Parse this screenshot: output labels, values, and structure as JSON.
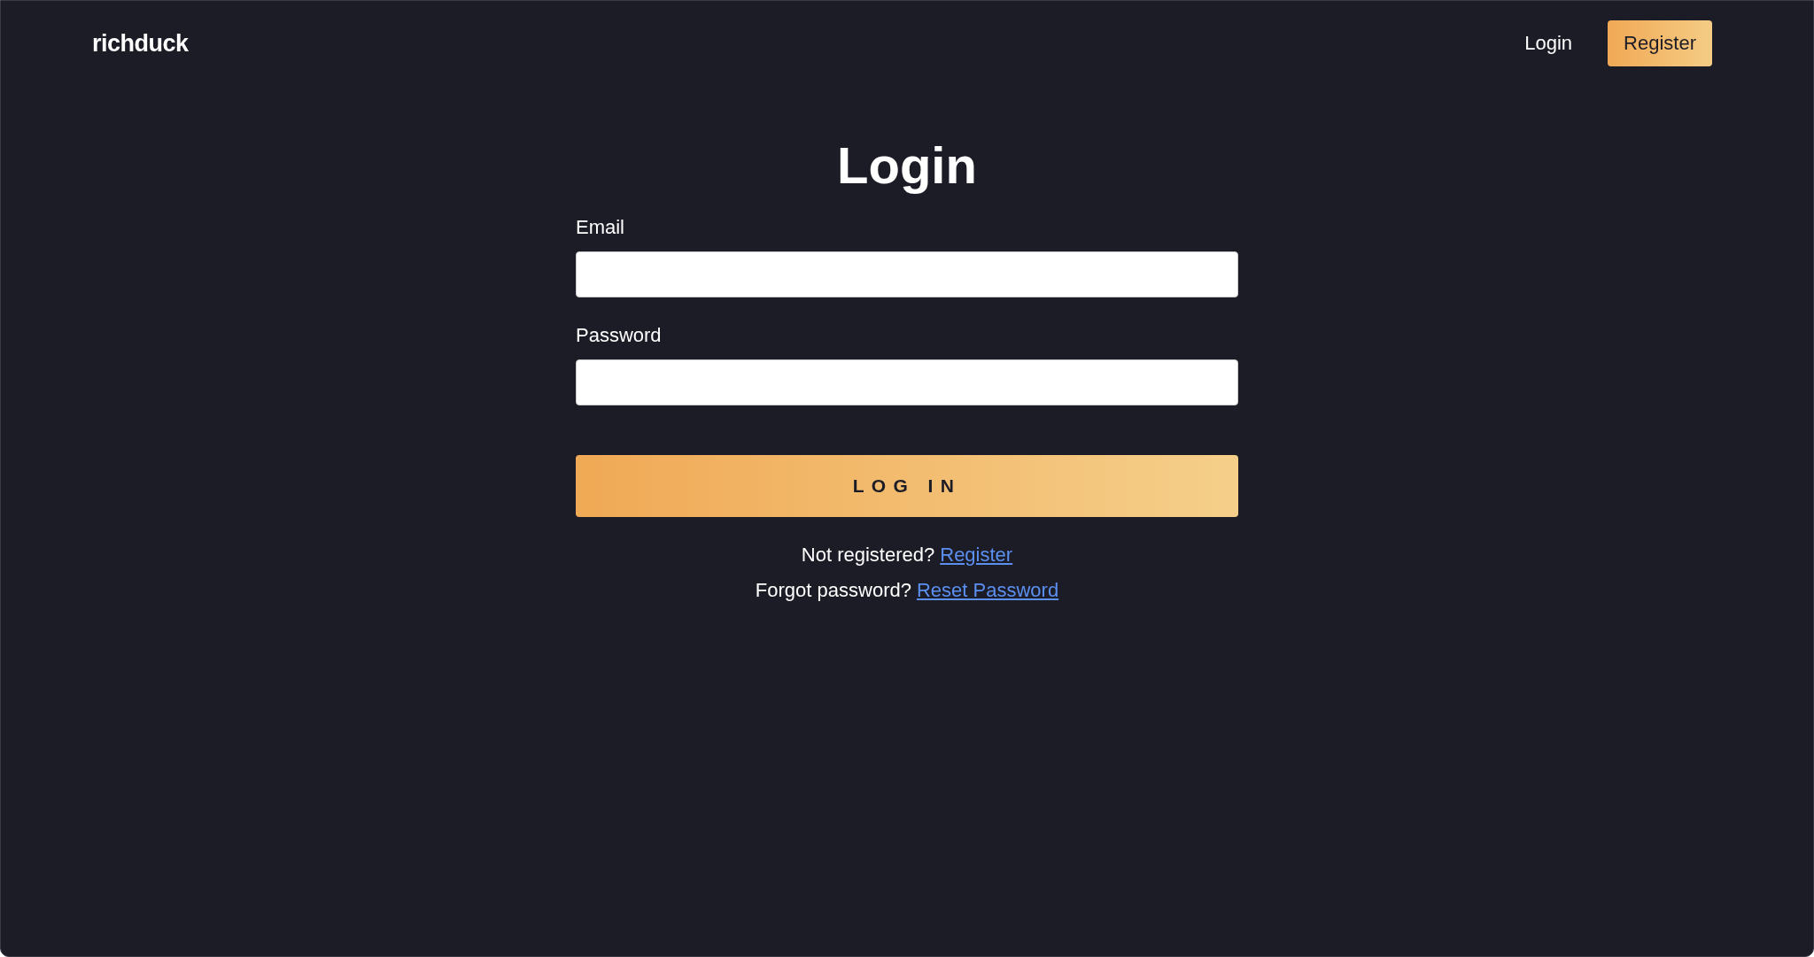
{
  "brand": "richduck",
  "nav": [
    {
      "label": "Login",
      "kind": "link"
    },
    {
      "label": "Register",
      "kind": "button"
    }
  ],
  "title": "Login",
  "fields": [
    {
      "label": "Email"
    },
    {
      "label": "Password"
    }
  ],
  "submit": "LOG IN",
  "links": [
    {
      "text": "Not registered?",
      "link": "Register"
    },
    {
      "text": "Forgot password?",
      "link": "Reset Password"
    }
  ]
}
